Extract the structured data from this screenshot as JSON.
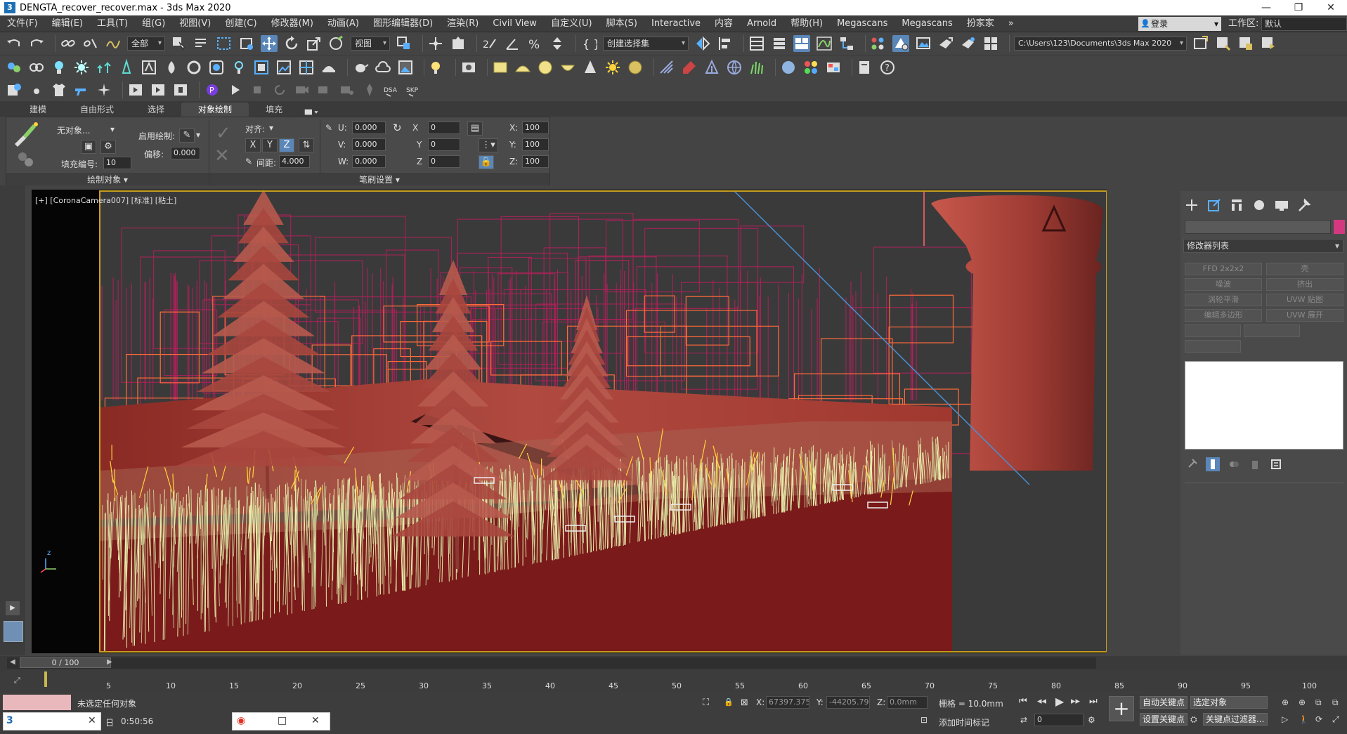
{
  "window": {
    "title": "DENGTA_recover_recover.max - 3ds Max 2020",
    "app_icon_glyph": "3",
    "minimize_glyph": "—",
    "maximize_glyph": "❐",
    "close_glyph": "✕"
  },
  "menu": {
    "items": [
      "文件(F)",
      "编辑(E)",
      "工具(T)",
      "组(G)",
      "视图(V)",
      "创建(C)",
      "修改器(M)",
      "动画(A)",
      "图形编辑器(D)",
      "渲染(R)",
      "Civil View",
      "自定义(U)",
      "脚本(S)",
      "Interactive",
      "内容",
      "Arnold",
      "帮助(H)",
      "Megascans",
      "Megascans",
      "扮家家"
    ],
    "overflow": "»",
    "login_label": "登录",
    "workspace_label": "工作区:",
    "workspace_value": "默认"
  },
  "toolbar": {
    "selection_filter": "全部",
    "ref_coord": "视图",
    "named_selection": "创建选择集",
    "project_path": "C:\\Users\\123\\Documents\\3ds Max 2020"
  },
  "ribbon": {
    "tabs": [
      "建模",
      "自由形式",
      "选择",
      "对象绘制",
      "填充"
    ],
    "active_tab": "对象绘制",
    "paint_object_label": "无对象...",
    "enable_paint_label": "启用绘制:",
    "offset_label": "偏移:",
    "offset_value": "0.000",
    "fill_number_label": "填充编号:",
    "fill_number_value": "10",
    "align_label": "对齐:",
    "axis_x": "X",
    "axis_y": "Y",
    "axis_z": "Z",
    "spacing_label": "间距:",
    "spacing_value": "4.000",
    "u_label": "U:",
    "u_value": "0.000",
    "v_label": "V:",
    "v_value": "0.000",
    "w_label": "W:",
    "w_value": "0.000",
    "rot_x_label": "X",
    "rot_x_value": "0",
    "rot_y_label": "Y",
    "rot_y_value": "0",
    "rot_z_label": "Z",
    "rot_z_value": "0",
    "scale_x_label": "X:",
    "scale_x_value": "100",
    "scale_y_label": "Y:",
    "scale_y_value": "100",
    "scale_z_label": "Z:",
    "scale_z_value": "100",
    "section_paint_objects": "绘制对象",
    "section_brush_settings": "笔刷设置"
  },
  "viewport": {
    "label": "[+] [CoronaCamera007] [标准] [粘土]",
    "colors": {
      "ground": "#7a1a1a",
      "wall": "#a83c34",
      "tower": "#b44a42",
      "grass": "#e9ecaa",
      "wire_orange": "#ff6a3a",
      "wire_magenta": "#b0205a",
      "sky": "#3a3a3a",
      "border": "#c8a020",
      "light_line": "#4a8fd0"
    }
  },
  "command_panel": {
    "modifier_list": "修改器列表",
    "modifier_buttons": [
      "FFD 2x2x2",
      "壳",
      "噪波",
      "挤出",
      "涡轮平滑",
      "UVW 贴图",
      "编辑多边形",
      "UVW 展开"
    ]
  },
  "timeline": {
    "slider_label": "0 / 100",
    "tick_labels": [
      "5",
      "10",
      "15",
      "20",
      "25",
      "30",
      "35",
      "40",
      "45",
      "50",
      "55",
      "60",
      "65",
      "70",
      "75",
      "80",
      "85",
      "90",
      "95",
      "100"
    ]
  },
  "status": {
    "message": "未选定任何对象",
    "time": "0:50:56",
    "time_prefix": "日",
    "x_label": "X:",
    "x_value": "67397.375",
    "y_label": "Y:",
    "y_value": "-44205.79",
    "z_label": "Z:",
    "z_value": "0.0mm",
    "grid_label": "栅格 = 10.0mm",
    "add_time_tag": "添加时间标记",
    "auto_key": "自动关键点",
    "selected_object": "选定对象",
    "set_key": "设置关键点",
    "key_filters": "关键点过滤器...",
    "frame_value": "0"
  },
  "taskbar": {
    "win1_close": "✕",
    "win2_restore": "□",
    "win2_close": "✕"
  }
}
